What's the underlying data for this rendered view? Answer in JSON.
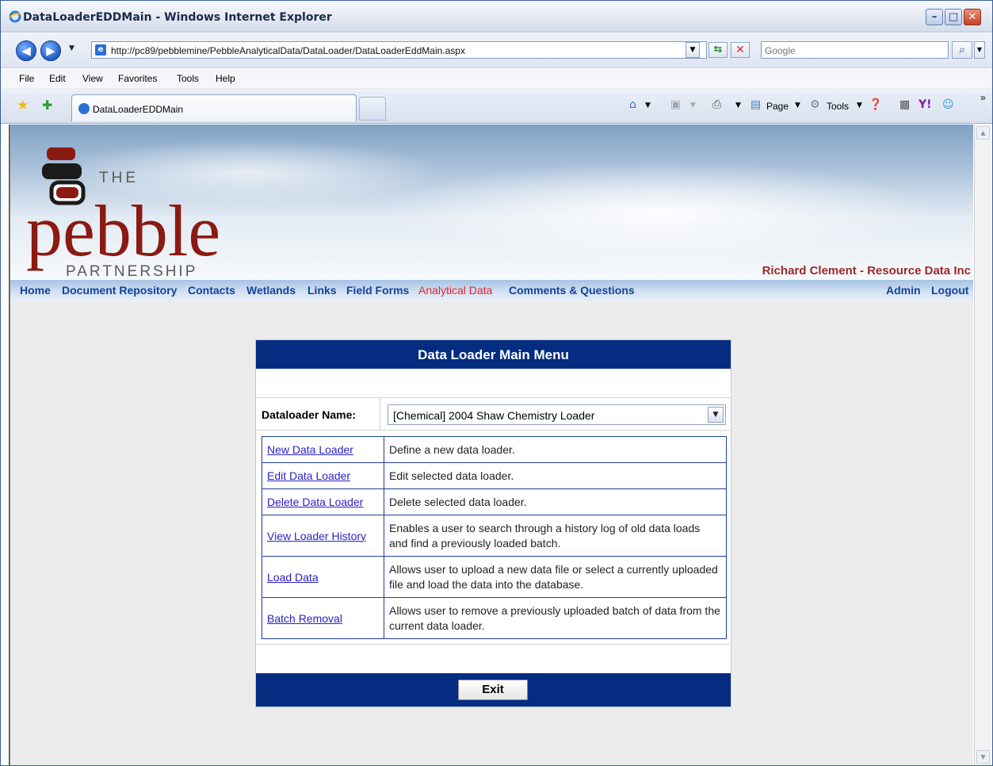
{
  "window": {
    "title": "DataLoaderEDDMain - Windows Internet Explorer",
    "min_glyph": "–",
    "max_glyph": "□",
    "close_glyph": "✕"
  },
  "address": {
    "url": "http://pc89/pebblemine/PebbleAnalyticalData/DataLoader/DataLoaderEddMain.aspx",
    "search_placeholder": "Google"
  },
  "menubar": [
    "File",
    "Edit",
    "View",
    "Favorites",
    "Tools",
    "Help"
  ],
  "tab": {
    "label": "DataLoaderEDDMain"
  },
  "commandbar": {
    "page_label": "Page",
    "tools_label": "Tools",
    "overflow": "»"
  },
  "site": {
    "logo_the": "THE",
    "logo_pebble": "pebble",
    "logo_partnership": "PARTNERSHIP",
    "user": "Richard Clement - Resource Data Inc",
    "nav": [
      "Home",
      "Document Repository",
      "Contacts",
      "Wetlands",
      "Links",
      "Field Forms",
      "Analytical Data",
      "Comments & Questions"
    ],
    "nav_right": [
      "Admin",
      "Logout"
    ]
  },
  "panel": {
    "title": "Data Loader Main Menu",
    "loader_label": "Dataloader Name:",
    "loader_selected": "[Chemical] 2004 Shaw Chemistry Loader",
    "rows": [
      {
        "link": "New Data Loader",
        "desc": "Define a new data loader."
      },
      {
        "link": "Edit Data Loader",
        "desc": "Edit selected data loader."
      },
      {
        "link": "Delete Data Loader",
        "desc": "Delete selected data loader."
      },
      {
        "link": "View Loader History",
        "desc": "Enables a user to search through a history log of old data loads and find a previously loaded batch."
      },
      {
        "link": "Load Data",
        "desc": "Allows user to upload a new data file or select a currently uploaded file and load the data into the database."
      },
      {
        "link": "Batch Removal",
        "desc": "Allows user to remove a previously uploaded batch of data from the current data loader."
      }
    ],
    "exit_label": "Exit"
  },
  "colors": {
    "panel_header": "#042d82",
    "nav_link": "#14429b",
    "nav_active": "#e8252a",
    "user_text": "#9b2a2a"
  }
}
